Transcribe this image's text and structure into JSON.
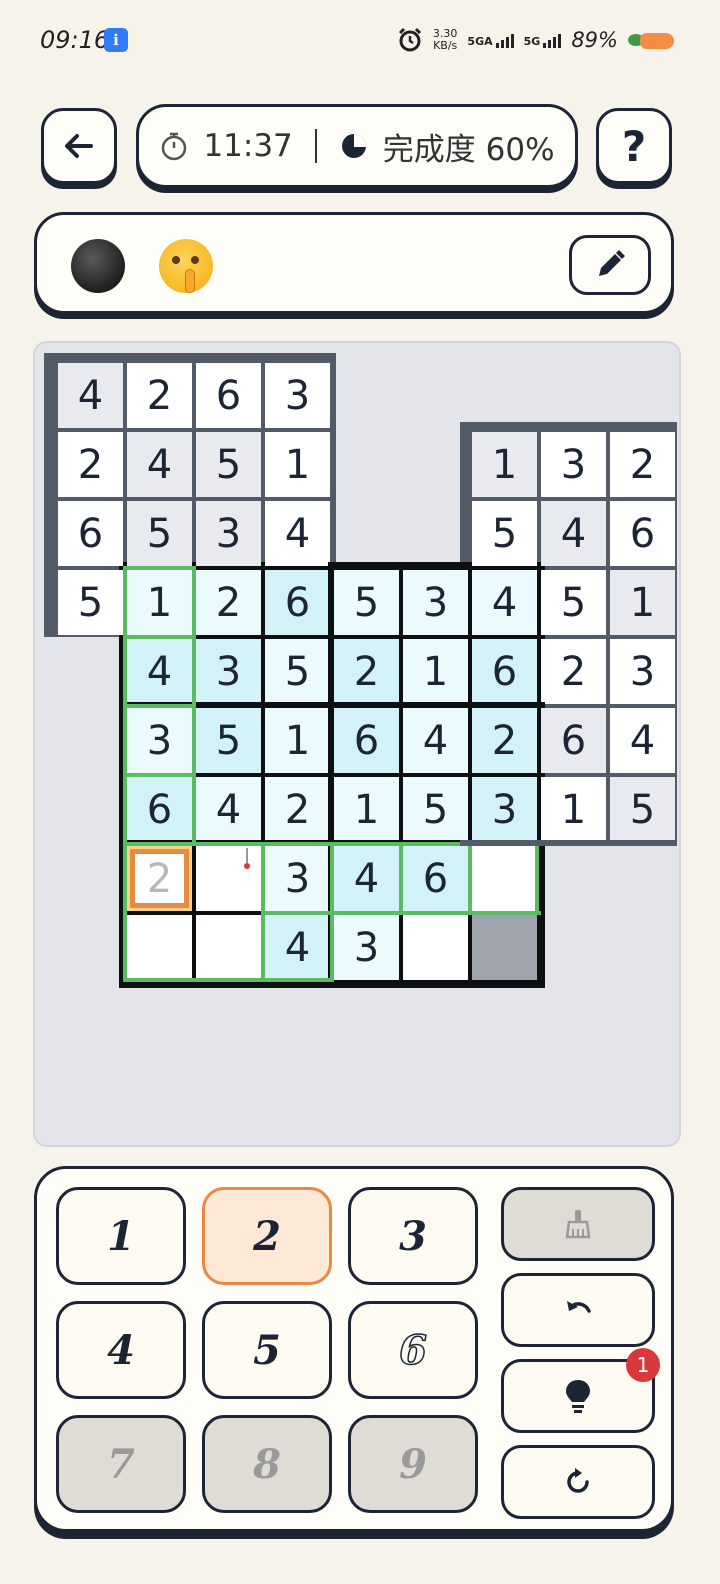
{
  "status_bar": {
    "time": "09:16",
    "app_badge": "ℹ",
    "net_speed_value": "3.30",
    "net_speed_unit": "KB/s",
    "sim1": "5GA",
    "sim2": "5G",
    "battery": "89%"
  },
  "header": {
    "timer": "11:37",
    "progress_label": "完成度 60%",
    "help_label": "?"
  },
  "board": {
    "cells": [
      {
        "r": 0,
        "c": 0,
        "v": "4",
        "bg": "#e9eaef"
      },
      {
        "r": 0,
        "c": 1,
        "v": "2",
        "bg": "#ffffff"
      },
      {
        "r": 0,
        "c": 2,
        "v": "6",
        "bg": "#ffffff"
      },
      {
        "r": 0,
        "c": 3,
        "v": "3",
        "bg": "#ffffff"
      },
      {
        "r": 1,
        "c": 0,
        "v": "2",
        "bg": "#ffffff"
      },
      {
        "r": 1,
        "c": 1,
        "v": "4",
        "bg": "#e9eaef"
      },
      {
        "r": 1,
        "c": 2,
        "v": "5",
        "bg": "#e9eaef"
      },
      {
        "r": 1,
        "c": 3,
        "v": "1",
        "bg": "#ffffff"
      },
      {
        "r": 2,
        "c": 0,
        "v": "6",
        "bg": "#ffffff"
      },
      {
        "r": 2,
        "c": 1,
        "v": "5",
        "bg": "#e9eaef"
      },
      {
        "r": 2,
        "c": 2,
        "v": "3",
        "bg": "#e9eaef"
      },
      {
        "r": 2,
        "c": 3,
        "v": "4",
        "bg": "#ffffff"
      },
      {
        "r": 3,
        "c": 0,
        "v": "5",
        "bg": "#ffffff"
      },
      {
        "r": 1,
        "c": 6,
        "v": "1",
        "bg": "#e9eaef"
      },
      {
        "r": 1,
        "c": 7,
        "v": "3",
        "bg": "#ffffff"
      },
      {
        "r": 1,
        "c": 8,
        "v": "2",
        "bg": "#ffffff"
      },
      {
        "r": 2,
        "c": 6,
        "v": "5",
        "bg": "#ffffff"
      },
      {
        "r": 2,
        "c": 7,
        "v": "4",
        "bg": "#e9eaef"
      },
      {
        "r": 2,
        "c": 8,
        "v": "6",
        "bg": "#ffffff"
      },
      {
        "r": 3,
        "c": 7,
        "v": "5",
        "bg": "#ffffff"
      },
      {
        "r": 3,
        "c": 8,
        "v": "1",
        "bg": "#e9eaef"
      },
      {
        "r": 4,
        "c": 7,
        "v": "2",
        "bg": "#ffffff"
      },
      {
        "r": 4,
        "c": 8,
        "v": "3",
        "bg": "#ffffff"
      },
      {
        "r": 5,
        "c": 7,
        "v": "6",
        "bg": "#e9eaef"
      },
      {
        "r": 5,
        "c": 8,
        "v": "4",
        "bg": "#ffffff"
      },
      {
        "r": 6,
        "c": 7,
        "v": "1",
        "bg": "#ffffff"
      },
      {
        "r": 6,
        "c": 8,
        "v": "5",
        "bg": "#e9eaef"
      },
      {
        "r": 3,
        "c": 1,
        "v": "1",
        "bg": "#eafafd"
      },
      {
        "r": 3,
        "c": 2,
        "v": "2",
        "bg": "#eafafd"
      },
      {
        "r": 3,
        "c": 3,
        "v": "6",
        "bg": "#d3f2f8"
      },
      {
        "r": 3,
        "c": 4,
        "v": "5",
        "bg": "#eafafd"
      },
      {
        "r": 3,
        "c": 5,
        "v": "3",
        "bg": "#eafafd"
      },
      {
        "r": 3,
        "c": 6,
        "v": "4",
        "bg": "#eafafd"
      },
      {
        "r": 4,
        "c": 1,
        "v": "4",
        "bg": "#d3f2f8"
      },
      {
        "r": 4,
        "c": 2,
        "v": "3",
        "bg": "#d3f2f8"
      },
      {
        "r": 4,
        "c": 3,
        "v": "5",
        "bg": "#eafafd"
      },
      {
        "r": 4,
        "c": 4,
        "v": "2",
        "bg": "#d3f2f8"
      },
      {
        "r": 4,
        "c": 5,
        "v": "1",
        "bg": "#eafafd"
      },
      {
        "r": 4,
        "c": 6,
        "v": "6",
        "bg": "#d3f2f8"
      },
      {
        "r": 5,
        "c": 1,
        "v": "3",
        "bg": "#eafafd"
      },
      {
        "r": 5,
        "c": 2,
        "v": "5",
        "bg": "#d3f2f8"
      },
      {
        "r": 5,
        "c": 3,
        "v": "1",
        "bg": "#eafafd"
      },
      {
        "r": 5,
        "c": 4,
        "v": "6",
        "bg": "#d3f2f8"
      },
      {
        "r": 5,
        "c": 5,
        "v": "4",
        "bg": "#eafafd"
      },
      {
        "r": 5,
        "c": 6,
        "v": "2",
        "bg": "#d3f2f8"
      },
      {
        "r": 6,
        "c": 1,
        "v": "6",
        "bg": "#d3f2f8"
      },
      {
        "r": 6,
        "c": 2,
        "v": "4",
        "bg": "#eafafd"
      },
      {
        "r": 6,
        "c": 3,
        "v": "2",
        "bg": "#eafafd"
      },
      {
        "r": 6,
        "c": 4,
        "v": "1",
        "bg": "#eafafd"
      },
      {
        "r": 6,
        "c": 5,
        "v": "5",
        "bg": "#eafafd"
      },
      {
        "r": 6,
        "c": 6,
        "v": "3",
        "bg": "#d3f2f8"
      },
      {
        "r": 7,
        "c": 1,
        "v": "2",
        "bg": "#ffffff",
        "draft": true
      },
      {
        "r": 7,
        "c": 2,
        "v": "",
        "bg": "#ffffff"
      },
      {
        "r": 7,
        "c": 3,
        "v": "3",
        "bg": "#eafafd"
      },
      {
        "r": 7,
        "c": 4,
        "v": "4",
        "bg": "#d3f2f8"
      },
      {
        "r": 7,
        "c": 5,
        "v": "6",
        "bg": "#d3f2f8"
      },
      {
        "r": 7,
        "c": 6,
        "v": "",
        "bg": "#ffffff"
      },
      {
        "r": 8,
        "c": 1,
        "v": "",
        "bg": "#ffffff"
      },
      {
        "r": 8,
        "c": 2,
        "v": "",
        "bg": "#ffffff"
      },
      {
        "r": 8,
        "c": 3,
        "v": "4",
        "bg": "#d3f2f8"
      },
      {
        "r": 8,
        "c": 4,
        "v": "3",
        "bg": "#eafafd"
      },
      {
        "r": 8,
        "c": 5,
        "v": "",
        "bg": "#ffffff"
      },
      {
        "r": 8,
        "c": 6,
        "v": "",
        "bg": "#9fa3ab"
      }
    ],
    "selected": {
      "r": 7,
      "c": 1
    }
  },
  "keypad": {
    "keys": [
      {
        "label": "1",
        "state": "normal"
      },
      {
        "label": "2",
        "state": "selected"
      },
      {
        "label": "3",
        "state": "normal"
      },
      {
        "label": "4",
        "state": "normal"
      },
      {
        "label": "5",
        "state": "normal"
      },
      {
        "label": "6",
        "state": "outlined"
      },
      {
        "label": "7",
        "state": "disabled"
      },
      {
        "label": "8",
        "state": "disabled"
      },
      {
        "label": "9",
        "state": "disabled"
      }
    ],
    "hint_count": "1"
  },
  "colors": {
    "accent_orange": "#e98a42",
    "region_green": "#5abb62",
    "grid_dark": "#545b68",
    "selected_fill": "#fde9d6"
  }
}
